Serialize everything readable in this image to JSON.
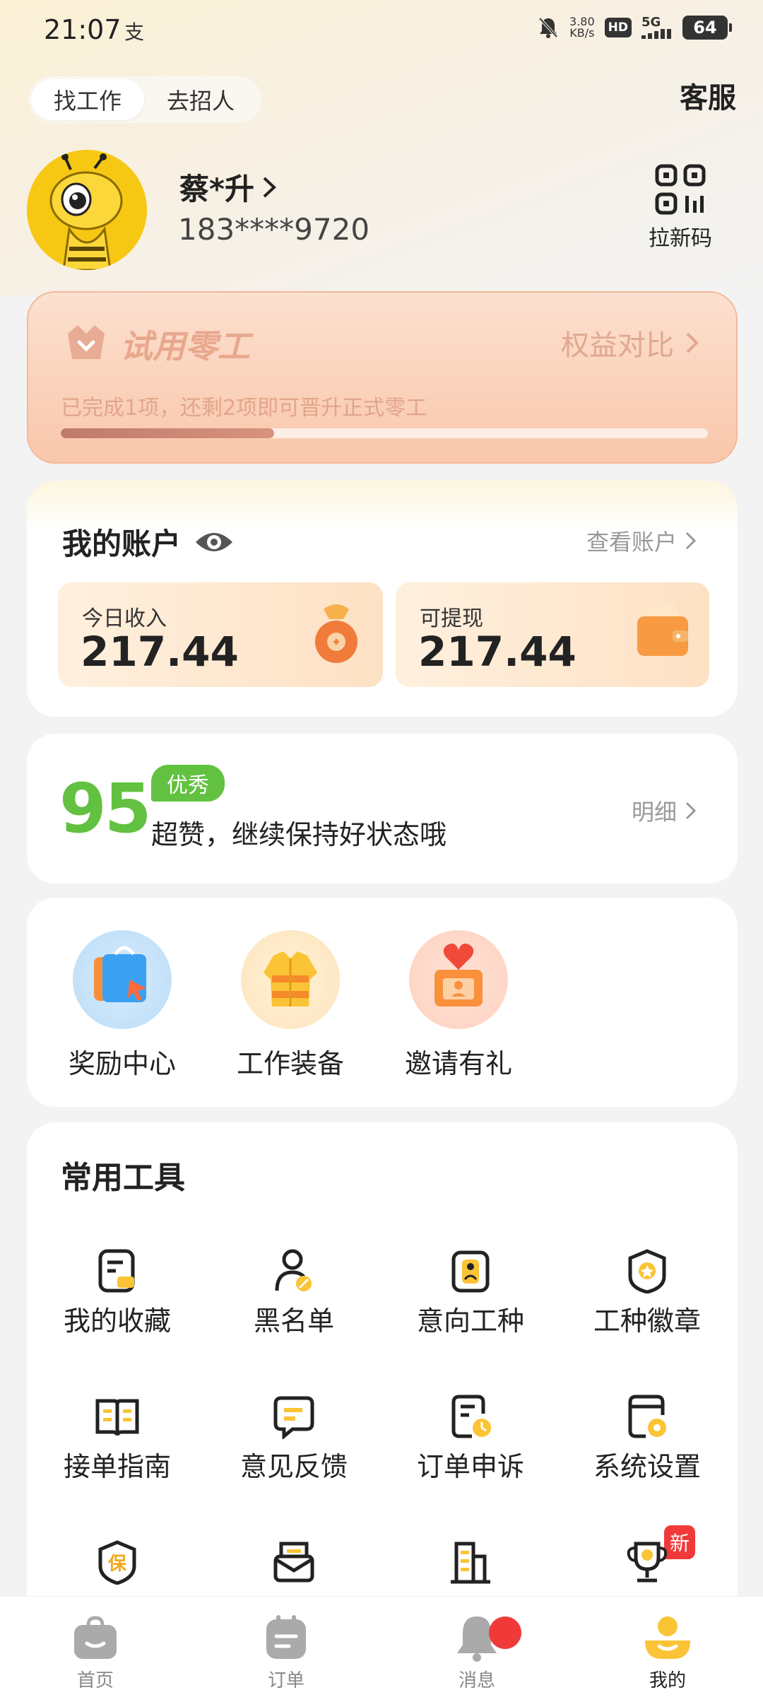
{
  "status_bar": {
    "time": "21:07",
    "alipay_glyph": "支",
    "net_speed": "3.80",
    "net_unit": "KB/s",
    "hd": "HD",
    "network": "5G",
    "battery": "64"
  },
  "header": {
    "mode_tabs": [
      {
        "label": "找工作",
        "active": true
      },
      {
        "label": "去招人",
        "active": false
      }
    ],
    "customer_service": "客服"
  },
  "profile": {
    "name": "蔡*升",
    "phone": "183****9720",
    "qr_label": "拉新码",
    "avatar_icon": "bee-mascot"
  },
  "trial": {
    "title": "试用零工",
    "compare_label": "权益对比",
    "description": "已完成1项，还剩2项即可晋升正式零工",
    "progress": 0.33,
    "accent": "#f9c7ab"
  },
  "account": {
    "title": "我的账户",
    "view_label": "查看账户",
    "today_income_label": "今日收入",
    "today_income": "217.44",
    "withdrawable_label": "可提现",
    "withdrawable": "217.44"
  },
  "score": {
    "value": "95",
    "badge": "优秀",
    "description": "超赞，继续保持好状态哦",
    "detail_label": "明细",
    "color": "#62c140"
  },
  "quick_entries": [
    {
      "label": "奖励中心",
      "icon": "shopping-bag-icon"
    },
    {
      "label": "工作装备",
      "icon": "jacket-icon"
    },
    {
      "label": "邀请有礼",
      "icon": "gift-heart-icon"
    }
  ],
  "tools": {
    "title": "常用工具",
    "items": [
      {
        "label": "我的收藏",
        "icon": "favorite-doc-icon"
      },
      {
        "label": "黑名单",
        "icon": "blocked-user-icon"
      },
      {
        "label": "意向工种",
        "icon": "id-card-icon"
      },
      {
        "label": "工种徽章",
        "icon": "badge-shield-icon"
      },
      {
        "label": "接单指南",
        "icon": "book-icon"
      },
      {
        "label": "意见反馈",
        "icon": "feedback-icon"
      },
      {
        "label": "订单申诉",
        "icon": "order-clock-icon"
      },
      {
        "label": "系统设置",
        "icon": "settings-doc-icon"
      },
      {
        "label": "",
        "icon": "insurance-shield-icon",
        "glyph": "保"
      },
      {
        "label": "",
        "icon": "mail-icon"
      },
      {
        "label": "",
        "icon": "building-icon"
      },
      {
        "label": "",
        "icon": "trophy-icon",
        "badge": "新"
      }
    ]
  },
  "bottom_nav": [
    {
      "label": "首页",
      "icon": "home-bag-icon",
      "active": false
    },
    {
      "label": "订单",
      "icon": "order-icon",
      "active": false
    },
    {
      "label": "消息",
      "icon": "bell-icon",
      "active": false,
      "dot": true
    },
    {
      "label": "我的",
      "icon": "profile-icon",
      "active": true
    }
  ]
}
